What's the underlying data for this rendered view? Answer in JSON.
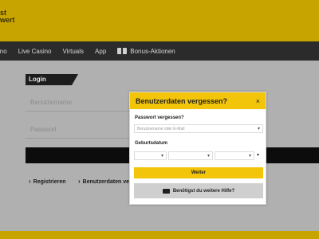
{
  "logo": {
    "line1": "st",
    "line2": "wert"
  },
  "nav": {
    "items": [
      "ino",
      "Live Casino",
      "Virtuals",
      "App",
      "Bonus-Aktionen"
    ]
  },
  "login": {
    "tab_label": "Login",
    "username_placeholder": "Benutzername",
    "password_placeholder": "Passwort",
    "register_link": "Registrieren",
    "forgot_link": "Benutzerdaten ver"
  },
  "modal": {
    "title": "Benutzerdaten vergessen?",
    "close_symbol": "×",
    "section_password": "Passwort vergessen?",
    "select_placeholder": "Benutzername oder E-Mail",
    "section_birthdate": "Geburtsdatum",
    "continue_button": "Weiter",
    "help_button": "Benötigst du weitere Hilfe?"
  },
  "icons": {
    "gift": "gift-icon",
    "mail": "mail-icon",
    "close": "close-icon"
  },
  "colors": {
    "brand_yellow": "#f2c40a",
    "nav_bg": "#2b2b2b"
  }
}
